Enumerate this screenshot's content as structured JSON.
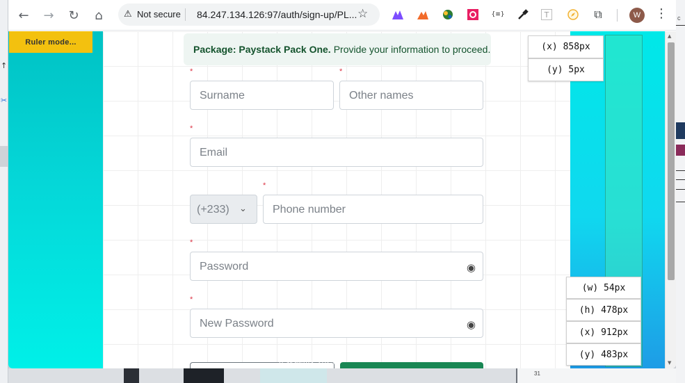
{
  "browser": {
    "security_label": "Not secure",
    "url": "84.247.134.126:97/auth/sign-up/PL...",
    "profile_initial": "W",
    "icons": {
      "back": "arrow-left-icon",
      "forward": "arrow-right-icon",
      "reload": "reload-icon",
      "home": "home-icon",
      "warning": "warning-triangle-icon",
      "bookmark": "star-icon",
      "extensions": "puzzle-icon",
      "menu": "kebab-menu-icon"
    },
    "extensions": [
      "purple-mountain-extension",
      "orange-mountain-extension",
      "globe-extension",
      "pink-gear-extension",
      "json-viewer-extension",
      "eyedropper-extension",
      "font-extension",
      "compass-extension"
    ],
    "extension_text": {
      "json": "{≡}",
      "font": "T"
    }
  },
  "page": {
    "ruler_badge": "Ruler mode...",
    "alert": {
      "strong": "Package: Paystack Pack One.",
      "text": "Provide your information to proceed."
    },
    "required_mark": "*",
    "form": {
      "surname_placeholder": "Surname",
      "other_names_placeholder": "Other names",
      "email_placeholder": "Email",
      "country_code": "(+233)",
      "phone_placeholder": "Phone number",
      "password_placeholder": "Password",
      "new_password_placeholder": "New Password"
    },
    "footer_fragment": "...n systems, 2023"
  },
  "ruler": {
    "x_top": "(x) 858px",
    "y_top": "(y) 5px",
    "w": "(w) 54px",
    "h": "(h) 478px",
    "x_bottom": "(x) 912px",
    "y_bottom": "(y) 483px"
  },
  "desktop": {
    "cell_number": "31",
    "right_letter": "c"
  },
  "colors": {
    "accent_green": "#198754",
    "alert_text": "#14532d",
    "ruler_badge": "#f3c10f",
    "required": "#dc3545"
  }
}
